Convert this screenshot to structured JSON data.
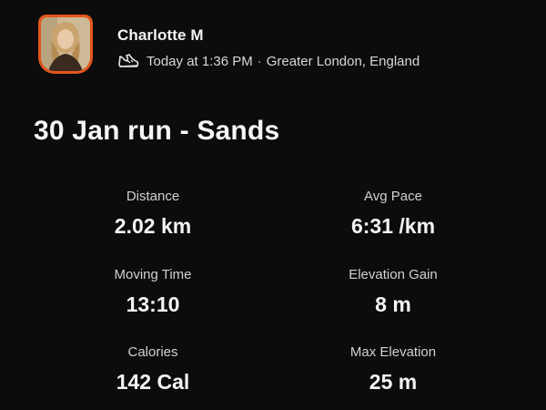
{
  "athlete": {
    "name": "Charlotte M",
    "timestamp": "Today at 1:36 PM",
    "separator": "·",
    "location": "Greater London, England",
    "activity_icon": "running-shoe-icon",
    "avatar_border_color": "#e4561a"
  },
  "activity": {
    "title": "30 Jan run - Sands"
  },
  "stats": [
    {
      "label": "Distance",
      "value": "2.02 km"
    },
    {
      "label": "Avg Pace",
      "value": "6:31 /km"
    },
    {
      "label": "Moving Time",
      "value": "13:10"
    },
    {
      "label": "Elevation Gain",
      "value": "8 m"
    },
    {
      "label": "Calories",
      "value": "142 Cal"
    },
    {
      "label": "Max Elevation",
      "value": "25 m"
    }
  ]
}
